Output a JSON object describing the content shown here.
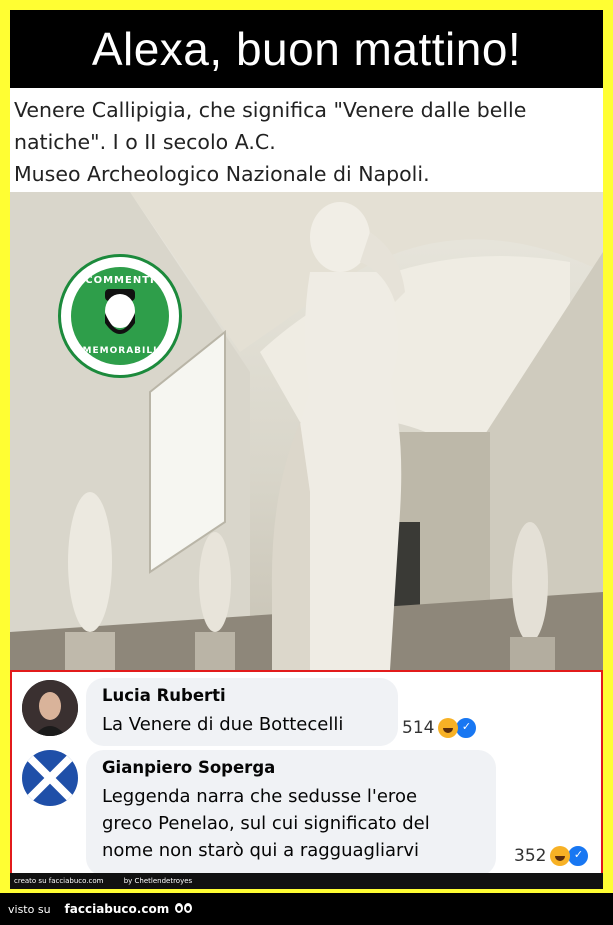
{
  "header": {
    "title": "Alexa, buon mattino!"
  },
  "caption": {
    "lines": [
      "Venere Callipigia, che significa \"Venere dalle belle",
      "natiche\". I o II secolo A.C.",
      "Museo Archeologico Nazionale di Napoli."
    ]
  },
  "logo": {
    "top_text": "COMMENTI",
    "bottom_text": "MEMORABILI",
    "mark": "TM"
  },
  "comments": [
    {
      "author": "Lucia Ruberti",
      "text": [
        "La Venere di due Bottecelli"
      ],
      "reactions": "514"
    },
    {
      "author": "Gianpiero Soperga",
      "text": [
        "Leggenda narra che sedusse l'eroe",
        "greco Penelao, sul cui significato del",
        "nome non starò qui a ragguagliarvi"
      ],
      "reactions": "352"
    }
  ],
  "credits": {
    "left": "creato su facciabuco.com",
    "by": "by Chetlendetroyes"
  },
  "footer": {
    "visto": "visto su",
    "site": "facciabuco.com"
  }
}
